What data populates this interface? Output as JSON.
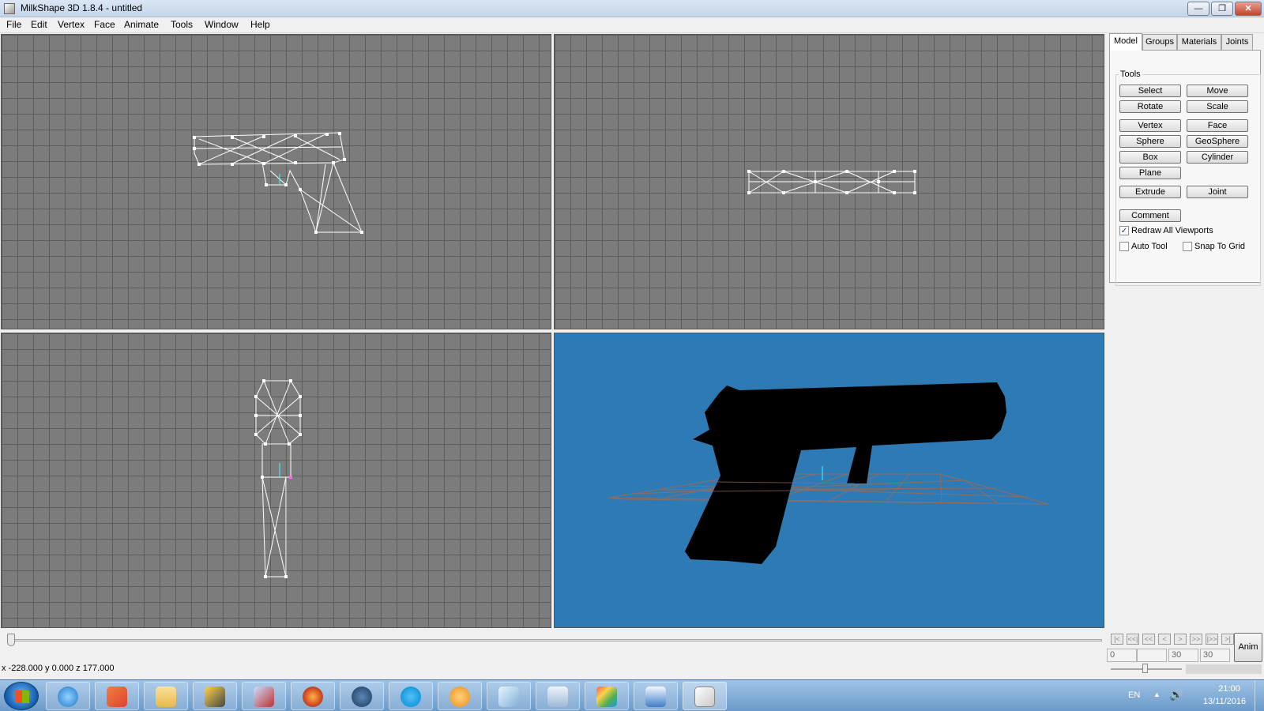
{
  "window": {
    "title": "MilkShape 3D 1.8.4 - untitled",
    "min_glyph": "—",
    "max_glyph": "❐",
    "close_glyph": "✕"
  },
  "menu": [
    "File",
    "Edit",
    "Vertex",
    "Face",
    "Animate",
    "Tools",
    "Window",
    "Help"
  ],
  "tabs": [
    "Model",
    "Groups",
    "Materials",
    "Joints"
  ],
  "active_tab": "Model",
  "tools": {
    "label": "Tools",
    "buttons": [
      "Select",
      "Move",
      "Rotate",
      "Scale",
      "Vertex",
      "Face",
      "Sphere",
      "GeoSphere",
      "Box",
      "Cylinder",
      "Plane",
      "Extrude",
      "Joint",
      "Comment"
    ],
    "checkboxes": [
      {
        "label": "Redraw All Viewports",
        "checked": true
      },
      {
        "label": "Auto Tool",
        "checked": false
      },
      {
        "label": "Snap To Grid",
        "checked": false
      }
    ]
  },
  "anim": {
    "nav_buttons": [
      "|<",
      "<<|",
      "<<",
      "<",
      ">",
      ">>",
      "|>>",
      ">|"
    ],
    "fields": [
      "0",
      "",
      "30",
      "30"
    ],
    "button": "Anim"
  },
  "status": "x -228.000 y 0.000 z 177.000",
  "viewport_3d_color": "#2e7ab4",
  "taskbar": {
    "apps": [
      "internet-explorer",
      "windows-explorer",
      "file-explorer",
      "app-yellow",
      "paint-tool",
      "firefox",
      "steam",
      "skype",
      "app-orange",
      "app-notes",
      "calculator",
      "app-colorful",
      "app-blue",
      "milkshape"
    ],
    "lang": "EN",
    "time": "21:00",
    "date": "13/11/2016"
  }
}
